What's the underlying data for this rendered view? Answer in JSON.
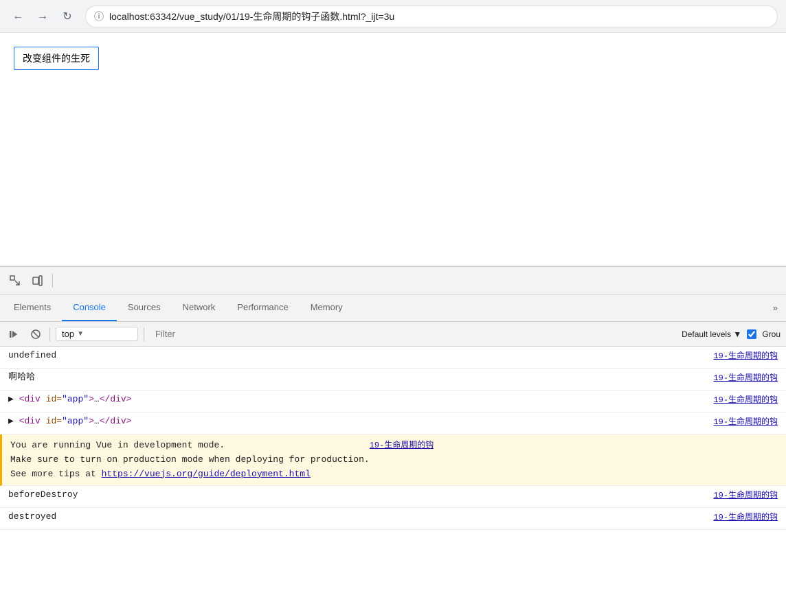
{
  "browser": {
    "url": "localhost:63342/vue_study/01/19-生命周期的钩子函数.html?_ijt=3u",
    "back_label": "←",
    "forward_label": "→",
    "reload_label": "↻"
  },
  "page": {
    "button_label": "改变组件的生死"
  },
  "devtools": {
    "tabs": [
      {
        "id": "elements",
        "label": "Elements",
        "active": false
      },
      {
        "id": "console",
        "label": "Console",
        "active": true
      },
      {
        "id": "sources",
        "label": "Sources",
        "active": false
      },
      {
        "id": "network",
        "label": "Network",
        "active": false
      },
      {
        "id": "performance",
        "label": "Performance",
        "active": false
      },
      {
        "id": "memory",
        "label": "Memory",
        "active": false
      },
      {
        "id": "more",
        "label": "»",
        "active": false
      }
    ],
    "console": {
      "context": "top",
      "filter_placeholder": "Filter",
      "default_levels": "Default levels ▼",
      "group_label": "Grou",
      "rows": [
        {
          "id": "row1",
          "text": "undefined",
          "link": "19-生命周期的钩",
          "has_arrow": false,
          "multiline": false
        },
        {
          "id": "row2",
          "text": "啊哈哈",
          "link": "19-生命周期的钩",
          "has_arrow": false,
          "multiline": false
        },
        {
          "id": "row3",
          "text_html": "▶ <span class='tag'>&lt;div</span> <span class='attr-name'>id=</span><span class='attr-value'>\"app\"</span><span class='tag'>&gt;</span>…<span class='tag'>&lt;/div&gt;</span>",
          "link": "19-生命周期的钩",
          "has_arrow": true,
          "multiline": false
        },
        {
          "id": "row4",
          "text_html": "▶ <span class='tag'>&lt;div</span> <span class='attr-name'>id=</span><span class='attr-value'>\"app\"</span><span class='tag'>&gt;</span>…<span class='tag'>&lt;/div&gt;</span>",
          "link": "19-生命周期的钩",
          "has_arrow": true,
          "multiline": false
        },
        {
          "id": "row5",
          "multiline": true,
          "lines": [
            "You are running Vue in development mode.",
            "Make sure to turn on production mode when deploying for production.",
            "See more tips at https://vuejs.org/guide/deployment.html"
          ],
          "link_text": "https://vuejs.org/guide/deployment.html",
          "link": "19-生命周期的钩",
          "warning": true
        },
        {
          "id": "row6",
          "text": "beforeDestroy",
          "link": "19-生命周期的钩",
          "has_arrow": false,
          "multiline": false
        },
        {
          "id": "row7",
          "text": "destroyed",
          "link": "19-生命周期的钩",
          "has_arrow": false,
          "multiline": false
        }
      ]
    }
  }
}
